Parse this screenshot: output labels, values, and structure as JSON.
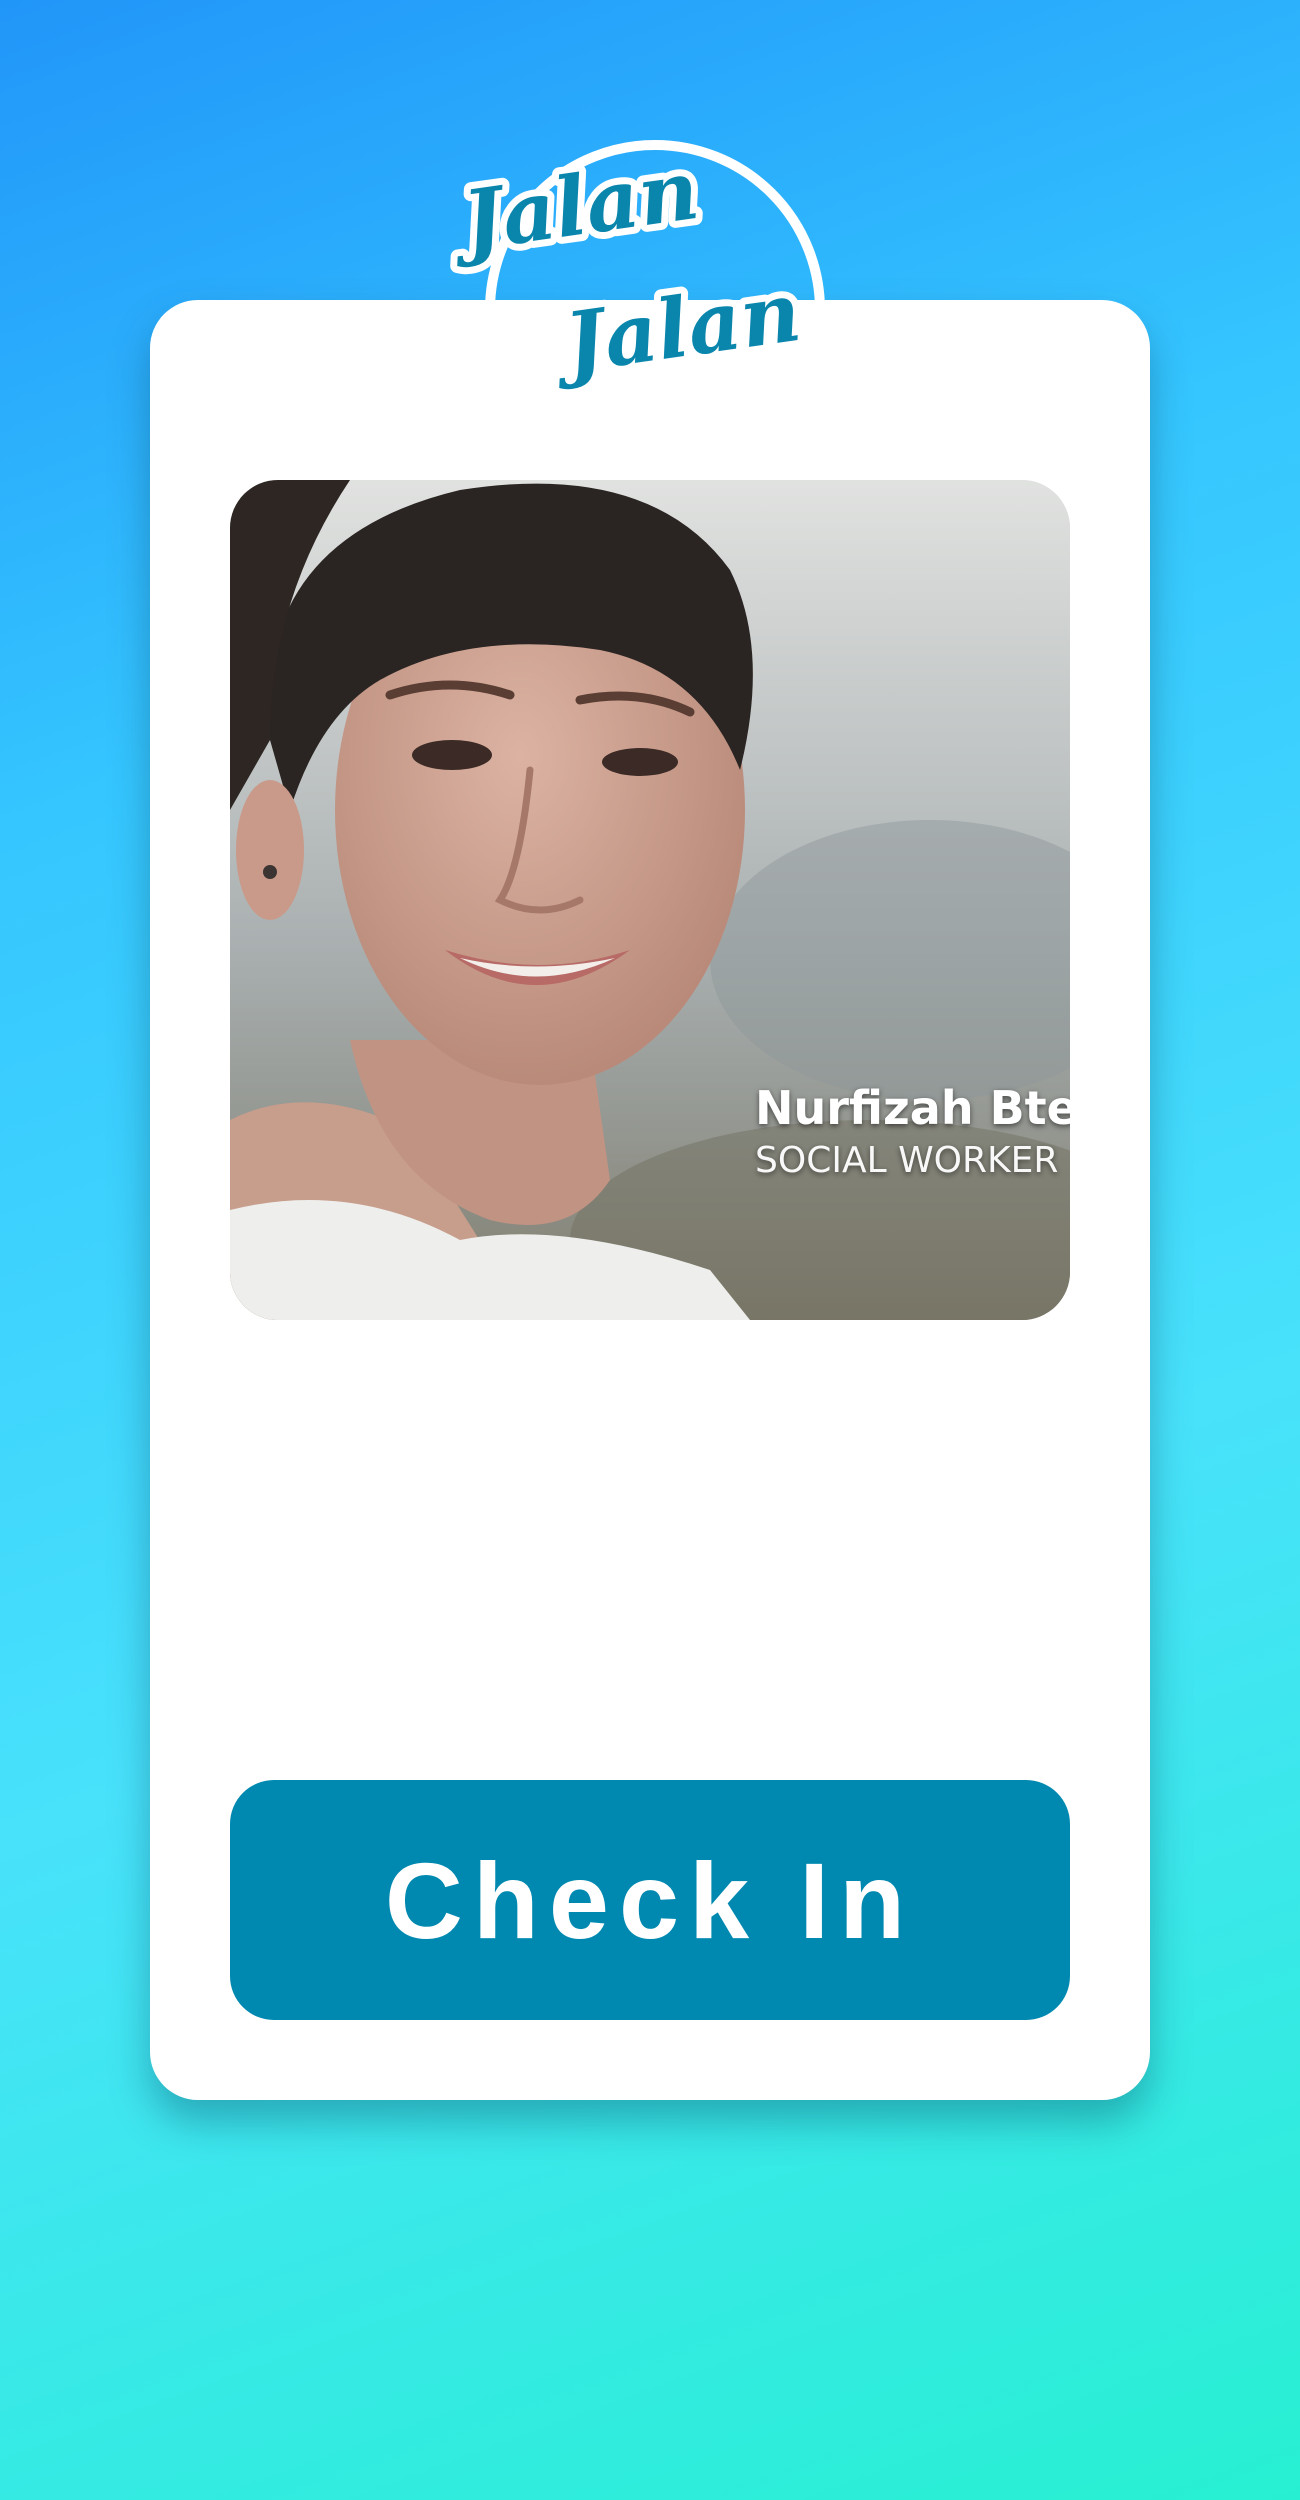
{
  "logo": {
    "line1": "Jalan",
    "line2": "Jalan"
  },
  "profile": {
    "photo_icon": "portrait-photo",
    "name": "Nurfizah Bte",
    "role": "SOCIAL WORKER"
  },
  "actions": {
    "check_in_label": "Check In"
  },
  "colors": {
    "background_start": "#2196f9",
    "background_end": "#27f0d2",
    "card": "#ffffff",
    "button": "#0089b0",
    "logo": "#0a86ad"
  }
}
